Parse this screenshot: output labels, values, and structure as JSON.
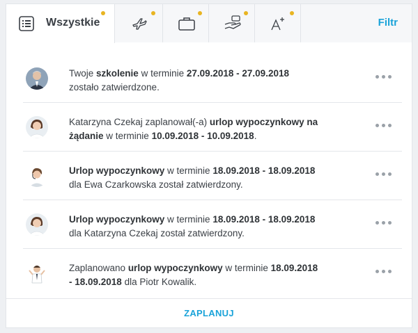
{
  "tabs": {
    "all_label": "Wszystkie",
    "filter_label": "Filtr",
    "icons": [
      "list-icon",
      "plane-icon",
      "briefcase-icon",
      "hand-coin-icon",
      "text-size-icon"
    ],
    "dot_color": "#e8b421"
  },
  "notifications": [
    {
      "pre": "Twoje ",
      "b1": "szkolenie",
      "mid": " w terminie ",
      "b2": "27.09.2018 - 27.09.2018",
      "post": " zostało zatwierdzone."
    },
    {
      "pre": "Katarzyna Czekaj zaplanował(-a) ",
      "b1": "urlop wypoczynkowy na żądanie",
      "mid": " w terminie ",
      "b2": "10.09.2018 - 10.09.2018",
      "post": "."
    },
    {
      "pre": "",
      "b1": "Urlop wypoczynkowy",
      "mid": " w terminie ",
      "b2": "18.09.2018 - 18.09.2018",
      "post": " dla Ewa Czarkowska został zatwierdzony."
    },
    {
      "pre": "",
      "b1": "Urlop wypoczynkowy",
      "mid": " w terminie ",
      "b2": "18.09.2018 - 18.09.2018",
      "post": " dla Katarzyna Czekaj został zatwierdzony."
    },
    {
      "pre": "Zaplanowano ",
      "b1": "urlop wypoczynkowy",
      "mid": " w terminie ",
      "b2": "18.09.2018 - 18.09.2018",
      "post": " dla Piotr Kowalik."
    }
  ],
  "footer": {
    "plan_label": "ZAPLANUJ"
  },
  "colors": {
    "accent": "#1aa3d9",
    "dot": "#e8b421"
  }
}
